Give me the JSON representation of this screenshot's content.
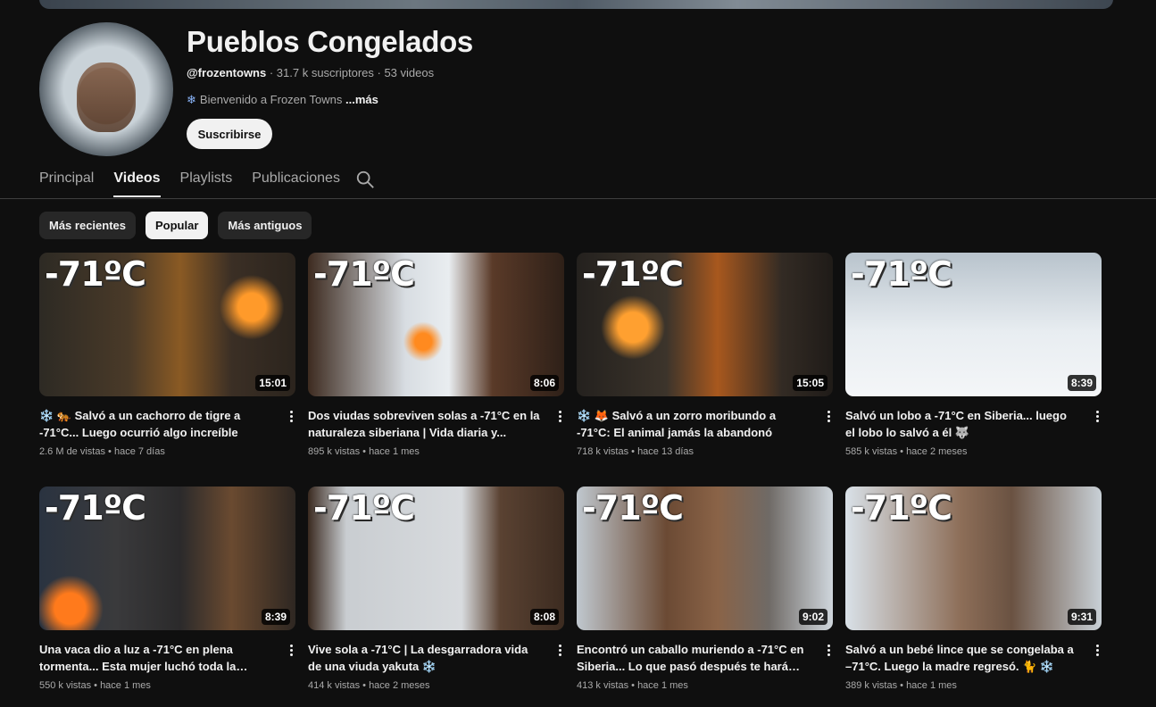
{
  "channel": {
    "name": "Pueblos Congelados",
    "handle": "@frozentowns",
    "meta_suffix": " · 31.7 k suscriptores · 53 videos",
    "description_icon": "snowflake-icon",
    "description": "Bienvenido a Frozen Towns",
    "more_label": "...más",
    "subscribe_label": "Suscribirse"
  },
  "tabs": [
    {
      "label": "Principal",
      "active": false
    },
    {
      "label": "Videos",
      "active": true
    },
    {
      "label": "Playlists",
      "active": false
    },
    {
      "label": "Publicaciones",
      "active": false
    }
  ],
  "chips": [
    {
      "label": "Más recientes",
      "active": false
    },
    {
      "label": "Popular",
      "active": true
    },
    {
      "label": "Más antiguos",
      "active": false
    }
  ],
  "videos": [
    {
      "overlay": "-71ºC",
      "duration": "15:01",
      "title": "❄️ 🐅 Salvó a un cachorro de tigre a -71°C... Luego ocurrió algo increíble",
      "views": "2.6 M de vistas",
      "age": "hace 7 días"
    },
    {
      "overlay": "-71ºC",
      "duration": "8:06",
      "title": "Dos viudas sobreviven solas a -71°C en la naturaleza siberiana | Vida diaria y...",
      "views": "895 k vistas",
      "age": "hace 1 mes"
    },
    {
      "overlay": "-71ºC",
      "duration": "15:05",
      "title": "❄️ 🦊 Salvó a un zorro moribundo a -71°C: El animal jamás la abandonó",
      "views": "718 k vistas",
      "age": "hace 13 días"
    },
    {
      "overlay": "-71ºC",
      "duration": "8:39",
      "title": "Salvó un lobo a -71°C en Siberia... luego el lobo lo salvó a él 🐺",
      "views": "585 k vistas",
      "age": "hace 2 meses"
    },
    {
      "overlay": "-71ºC",
      "duration": "8:39",
      "title": "Una vaca dio a luz a -71°C en plena tormenta... Esta mujer luchó toda la noche...",
      "views": "550 k vistas",
      "age": "hace 1 mes"
    },
    {
      "overlay": "-71ºC",
      "duration": "8:08",
      "title": "Vive sola a -71°C | La desgarradora vida de una viuda yakuta ❄️",
      "views": "414 k vistas",
      "age": "hace 2 meses"
    },
    {
      "overlay": "-71ºC",
      "duration": "9:02",
      "title": "Encontró un caballo muriendo a -71°C en Siberia... Lo que pasó después te hará llora...",
      "views": "413 k vistas",
      "age": "hace 1 mes"
    },
    {
      "overlay": "-71ºC",
      "duration": "9:31",
      "title": "Salvó a un bebé lince que se congelaba a –71°C. Luego la madre regresó. 🐈 ❄️",
      "views": "389 k vistas",
      "age": "hace 1 mes"
    }
  ],
  "stats_separator": " • "
}
